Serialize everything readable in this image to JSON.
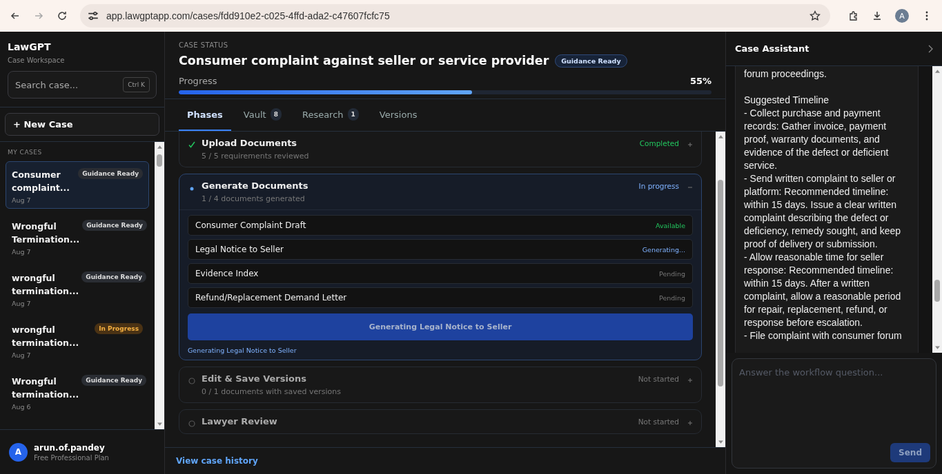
{
  "browser": {
    "url": "app.lawgptapp.com/cases/fdd910e2-c025-4ffd-ada2-c47607fcfc75",
    "avatar": "A"
  },
  "sidebar": {
    "brand": "LawGPT",
    "subtitle": "Case Workspace",
    "search": {
      "placeholder": "Search case...",
      "shortcut": "Ctrl K"
    },
    "new_case": "+ New Case",
    "section": "MY CASES",
    "cases": [
      {
        "title": "Consumer complaint...",
        "date": "Aug 7",
        "badge": "Guidance Ready",
        "kind": "ready",
        "selected": true
      },
      {
        "title": "Wrongful Termination...",
        "date": "Aug 7",
        "badge": "Guidance Ready",
        "kind": "ready",
        "selected": false
      },
      {
        "title": "wrongful termination...",
        "date": "Aug 7",
        "badge": "Guidance Ready",
        "kind": "ready",
        "selected": false
      },
      {
        "title": "wrongful termination...",
        "date": "Aug 7",
        "badge": "In Progress",
        "kind": "progress",
        "selected": false
      },
      {
        "title": "Wrongful termination...",
        "date": "Aug 6",
        "badge": "Guidance Ready",
        "kind": "ready",
        "selected": false
      }
    ],
    "user": {
      "initial": "A",
      "name": "arun.of.pandey",
      "plan": "Free Professional Plan"
    }
  },
  "main": {
    "eyebrow": "CASE STATUS",
    "title": "Consumer complaint against seller or service provider",
    "badge": "Guidance Ready",
    "progress": {
      "label": "Progress",
      "level": 0.55,
      "reading": "55%"
    },
    "tabs": [
      {
        "label": "Phases",
        "selected": true
      },
      {
        "label": "Vault",
        "count": "8",
        "selected": false
      },
      {
        "label": "Research",
        "count": "1",
        "selected": false
      },
      {
        "label": "Versions",
        "selected": false
      }
    ],
    "phases": [
      {
        "kind": "completed",
        "title": "Upload Documents",
        "subtitle": "5 / 5 requirements reviewed",
        "status": "Completed",
        "expanded": false
      },
      {
        "kind": "active",
        "title": "Generate Documents",
        "subtitle": "1 / 4 documents generated",
        "status": "In progress",
        "expanded": true,
        "documents": [
          {
            "name": "Consumer Complaint Draft",
            "status": "Available",
            "kind": "available"
          },
          {
            "name": "Legal Notice to Seller",
            "status": "Generating...",
            "kind": "generating"
          },
          {
            "name": "Evidence Index",
            "status": "Pending",
            "kind": "pending"
          },
          {
            "name": "Refund/Replacement Demand Letter",
            "status": "Pending",
            "kind": "pending"
          }
        ],
        "action": "Generating Legal Notice to Seller",
        "note": "Generating Legal Notice to Seller"
      },
      {
        "kind": "not_started",
        "title": "Edit & Save Versions",
        "subtitle": "0 / 1 documents with saved versions",
        "status": "Not started",
        "expanded": false
      },
      {
        "kind": "not_started",
        "title": "Lawyer Review",
        "status": "Not started",
        "expanded": false
      }
    ],
    "history_link": "View case history"
  },
  "assistant": {
    "title": "Case Assistant",
    "message": [
      [
        "forum proceedings."
      ],
      [
        "Suggested Timeline",
        "- Collect purchase and payment records: Gather invoice, payment proof, warranty documents, and evidence of the defect or deficient service.",
        "- Send written complaint to seller or platform: Recommended timeline: within 15 days. Issue a clear written complaint describing the defect or deficiency, remedy sought, and keep proof of delivery or submission.",
        "- Allow reasonable time for seller response: Recommended timeline: within 15 days. After a written complaint, allow a reasonable period for repair, replacement, refund, or response before escalation.",
        "- File complaint with consumer forum"
      ]
    ],
    "composer": {
      "placeholder": "Answer the workflow question...",
      "send": "Send"
    }
  }
}
